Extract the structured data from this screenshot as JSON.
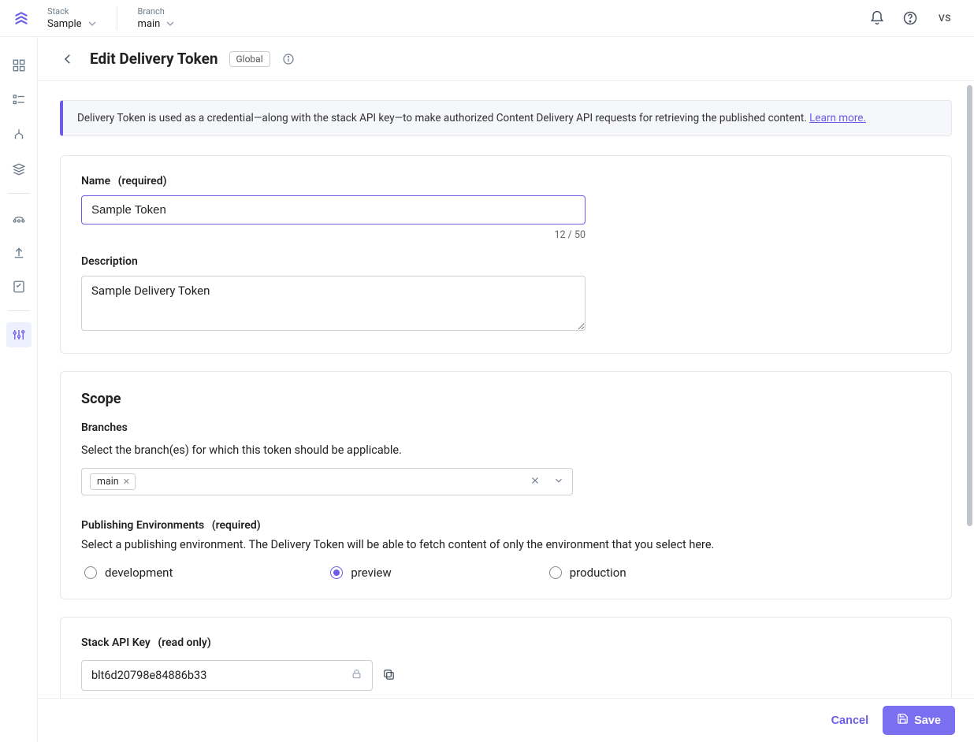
{
  "topbar": {
    "stack_label": "Stack",
    "stack_value": "Sample",
    "branch_label": "Branch",
    "branch_value": "main",
    "avatar": "VS"
  },
  "header": {
    "title": "Edit Delivery Token",
    "badge": "Global"
  },
  "banner": {
    "text": "Delivery Token is used as a credential—along with the stack API key—to make authorized Content Delivery API requests for retrieving the published content. ",
    "link": "Learn more."
  },
  "form": {
    "name_label": "Name",
    "name_hint": "(required)",
    "name_value": "Sample Token",
    "name_counter": "12 / 50",
    "desc_label": "Description",
    "desc_value": "Sample Delivery Token"
  },
  "scope": {
    "title": "Scope",
    "branches_label": "Branches",
    "branches_help": "Select the branch(es) for which this token should be applicable.",
    "branch_chip": "main",
    "env_label": "Publishing Environments",
    "env_hint": "(required)",
    "env_help": "Select a publishing environment. The Delivery Token will be able to fetch content of only the environment that you select here.",
    "env_options": [
      {
        "label": "development",
        "checked": false
      },
      {
        "label": "preview",
        "checked": true
      },
      {
        "label": "production",
        "checked": false
      }
    ]
  },
  "api": {
    "label": "Stack API Key",
    "hint": "(read only)",
    "value": "blt6d20798e84886b33"
  },
  "footer": {
    "cancel": "Cancel",
    "save": "Save"
  }
}
